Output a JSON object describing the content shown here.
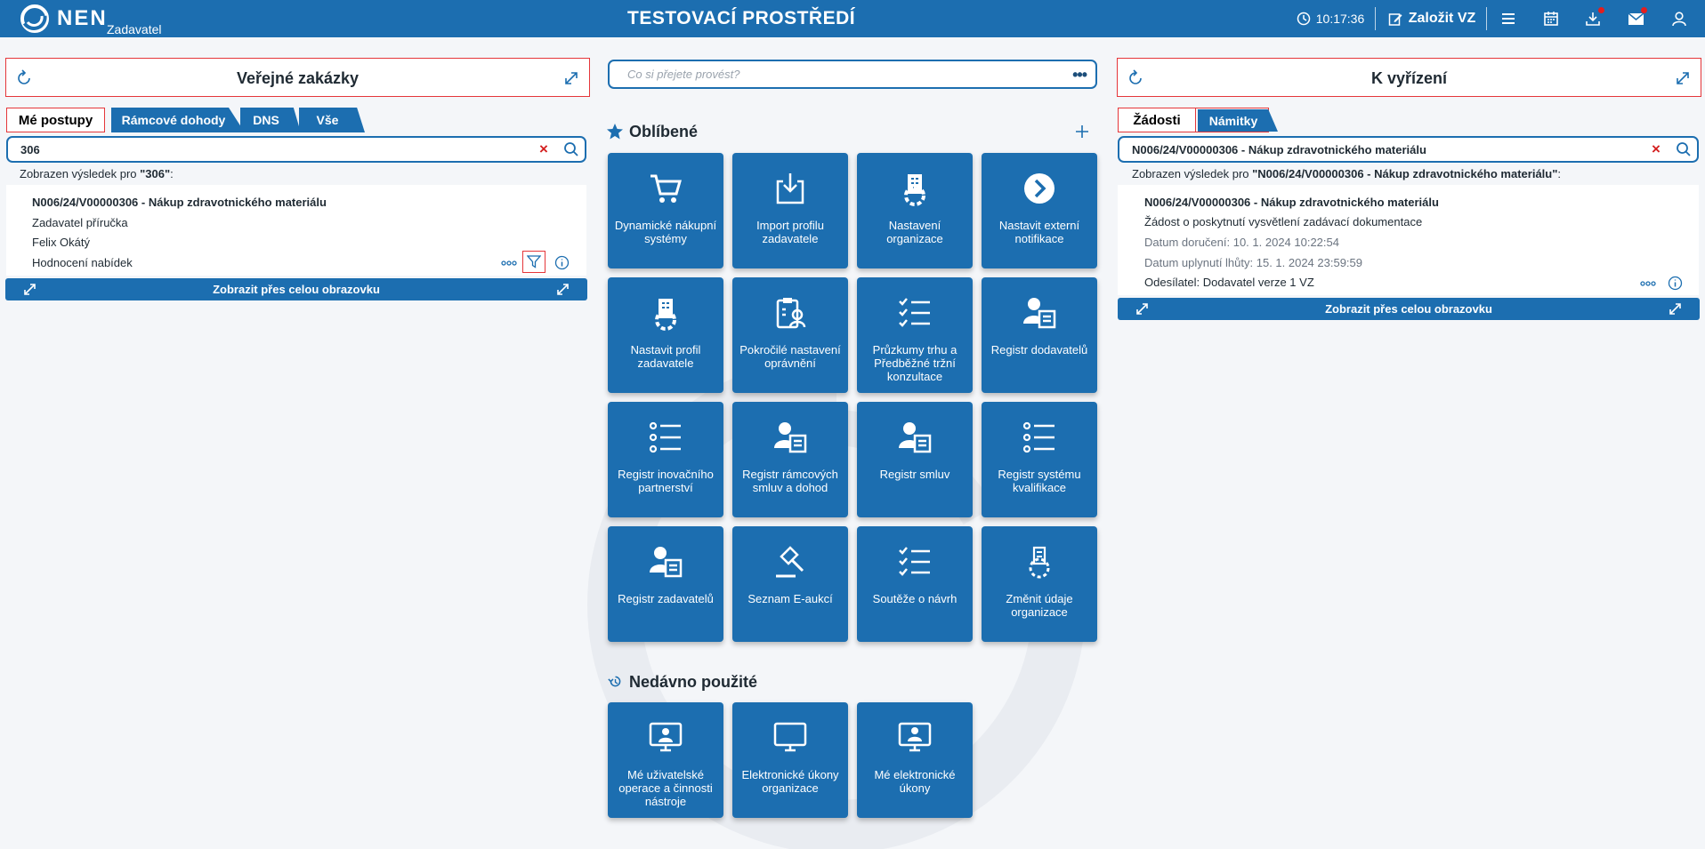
{
  "header": {
    "logo_text": "NEN",
    "logo_sub": "Zadavatel",
    "env_title": "TESTOVACÍ PROSTŘEDÍ",
    "time": "10:17:36",
    "create_label": "Založit VZ",
    "icons": [
      "clock-icon",
      "edit-icon",
      "menu-icon",
      "calendar-icon",
      "download-icon",
      "mail-icon",
      "user-icon"
    ],
    "notif_color": "#e41e1e",
    "brand_color": "#1c6eb0"
  },
  "left": {
    "title": "Veřejné zakázky",
    "tabs": [
      "Mé postupy",
      "Rámcové dohody",
      "DNS",
      "Vše"
    ],
    "search_value": "306",
    "result_prefix": "Zobrazen výsledek pro ",
    "result_query": "\"306\"",
    "result_suffix": ":",
    "item": {
      "title": "N006/24/V00000306 - Nákup zdravotnického materiálu",
      "org": "Zadavatel příručka",
      "person": "Felix Okátý",
      "phase": "Hodnocení nabídek"
    },
    "fullscreen_label": "Zobrazit přes celou obrazovku"
  },
  "center": {
    "command_placeholder": "Co si přejete provést?",
    "favorites_title": "Oblíbené",
    "favorites": [
      {
        "label": "Dynamické nákupní systémy",
        "icon": "cart-icon"
      },
      {
        "label": "Import profilu zadavatele",
        "icon": "import-icon"
      },
      {
        "label": "Nastavení organizace",
        "icon": "org-settings-icon"
      },
      {
        "label": "Nastavit externí notifikace",
        "icon": "arrow-circle-icon"
      },
      {
        "label": "Nastavit profil zadavatele",
        "icon": "profile-settings-icon"
      },
      {
        "label": "Pokročilé nastavení oprávnění",
        "icon": "permissions-icon"
      },
      {
        "label": "Průzkumy trhu a Předběžné tržní konzultace",
        "icon": "checklist-icon"
      },
      {
        "label": "Registr dodavatelů",
        "icon": "person-card-icon"
      },
      {
        "label": "Registr inovačního partnerství",
        "icon": "list-icon"
      },
      {
        "label": "Registr rámcových smluv a dohod",
        "icon": "person-card-icon"
      },
      {
        "label": "Registr smluv",
        "icon": "person-card-icon"
      },
      {
        "label": "Registr systému kvalifikace",
        "icon": "list-icon"
      },
      {
        "label": "Registr zadavatelů",
        "icon": "person-card-icon"
      },
      {
        "label": "Seznam E-aukcí",
        "icon": "gavel-icon"
      },
      {
        "label": "Soutěže o návrh",
        "icon": "checklist-icon"
      },
      {
        "label": "Změnit údaje organizace",
        "icon": "org-edit-icon"
      }
    ],
    "recent_title": "Nedávno použité",
    "recent": [
      {
        "label": "Mé uživatelské operace a činnosti nástroje",
        "icon": "monitor-user-icon"
      },
      {
        "label": "Elektronické úkony organizace",
        "icon": "monitor-icon"
      },
      {
        "label": "Mé elektronické úkony",
        "icon": "monitor-person-icon"
      }
    ]
  },
  "right": {
    "title": "K vyřízení",
    "tabs": [
      "Žádosti",
      "Námitky"
    ],
    "search_value": "N006/24/V00000306 - Nákup zdravotnického materiálu",
    "result_prefix": "Zobrazen výsledek pro ",
    "result_query": "\"N006/24/V00000306 - Nákup zdravotnického materiálu\"",
    "result_suffix": ":",
    "item": {
      "title": "N006/24/V00000306 - Nákup zdravotnického materiálu",
      "subject": "Žádost o poskytnutí vysvětlení zadávací dokumentace",
      "delivered": "Datum doručení: 10. 1. 2024 10:22:54",
      "deadline": "Datum uplynutí lhůty: 15. 1. 2024 23:59:59",
      "sender": "Odesílatel: Dodavatel verze 1 VZ"
    },
    "fullscreen_label": "Zobrazit přes celou obrazovku"
  }
}
